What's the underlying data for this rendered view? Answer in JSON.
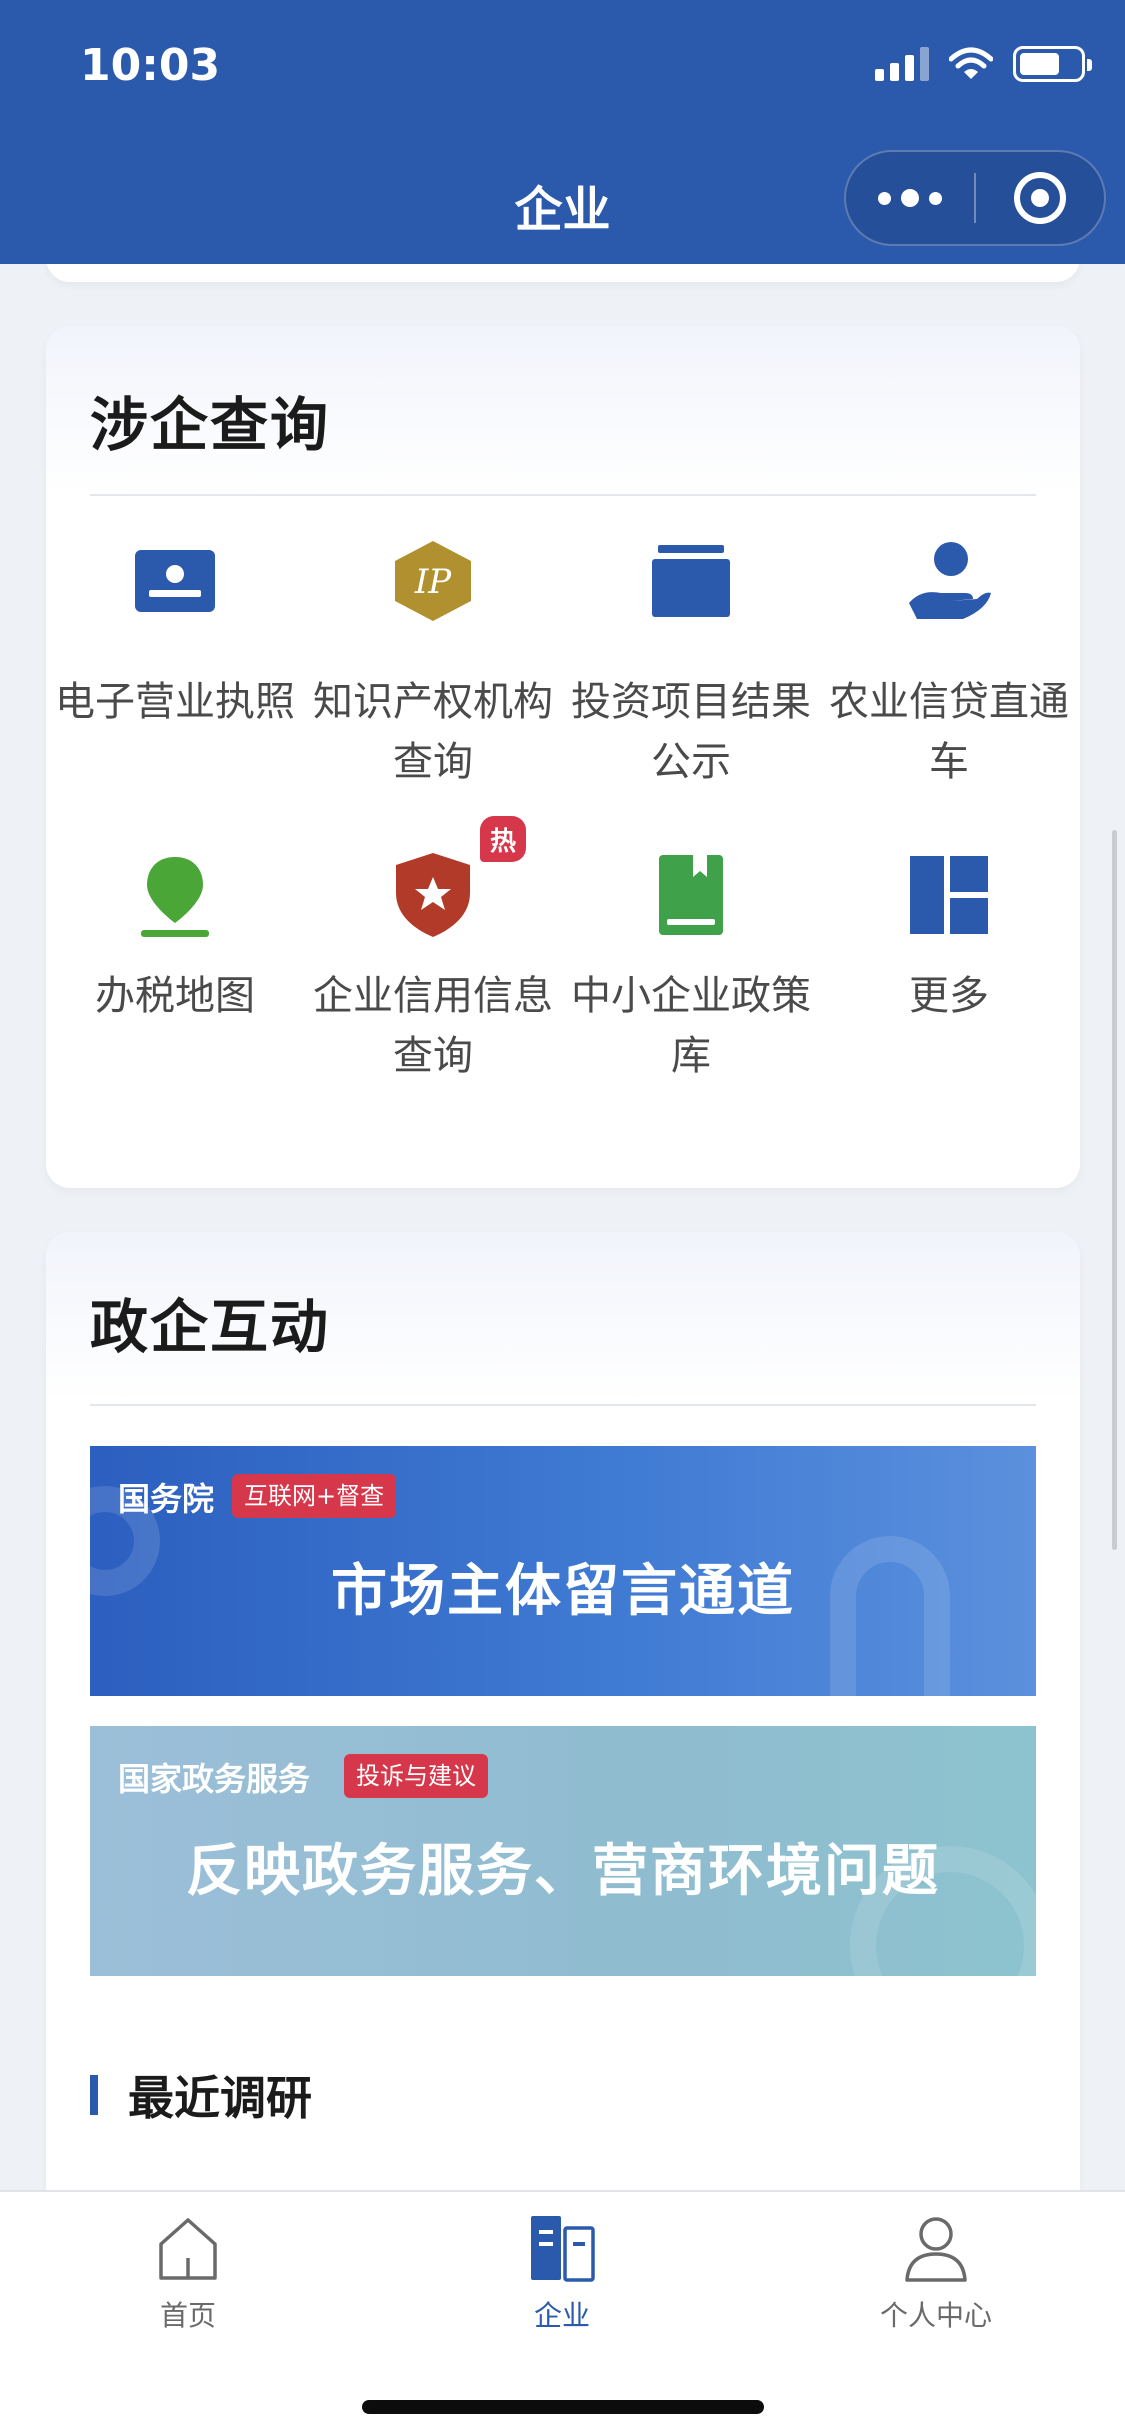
{
  "status_bar": {
    "time": "10:03"
  },
  "nav": {
    "title": "企业"
  },
  "query_card": {
    "title": "涉企查询",
    "items": [
      {
        "label": "电子营业执照",
        "icon": "license-card-icon"
      },
      {
        "label": "知识产权机构查询",
        "icon": "ip-badge-icon"
      },
      {
        "label": "投资项目结果公示",
        "icon": "folder-box-icon"
      },
      {
        "label": "农业信贷直通车",
        "icon": "hand-person-icon"
      },
      {
        "label": "办税地图",
        "icon": "map-pin-icon"
      },
      {
        "label": "企业信用信息查询",
        "icon": "shield-star-icon",
        "badge": "热"
      },
      {
        "label": "中小企业政策库",
        "icon": "book-icon"
      },
      {
        "label": "更多",
        "icon": "grid-more-icon"
      }
    ],
    "colors": {
      "blue": "#2b5aad",
      "gold": "#b0902f",
      "green": "#4aa636",
      "red": "#b23a28",
      "book_green": "#3fa14a"
    }
  },
  "interaction_card": {
    "title": "政企互动",
    "banners": [
      {
        "org": "国务院",
        "tag": "互联网+督查",
        "text": "市场主体留言通道"
      },
      {
        "org": "国家政务服务",
        "tag": "投诉与建议",
        "text": "反映政务服务、营商环境问题"
      }
    ],
    "recent_title": "最近调研"
  },
  "tabbar": {
    "tabs": [
      {
        "label": "首页",
        "icon": "home-icon",
        "active": false
      },
      {
        "label": "企业",
        "icon": "enterprise-icon",
        "active": true
      },
      {
        "label": "个人中心",
        "icon": "person-icon",
        "active": false
      }
    ],
    "active_color": "#2b5aad"
  }
}
